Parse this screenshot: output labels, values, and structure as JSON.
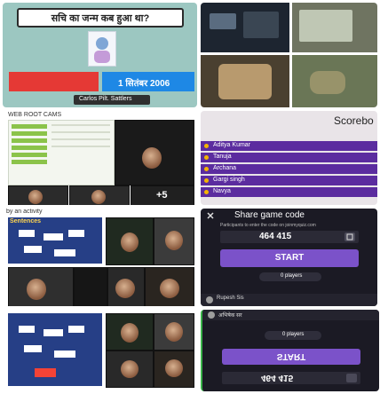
{
  "panel_a": {
    "question": "सचि का जन्म कब हुआ था?",
    "answer_option": "1 सितंबर 2006",
    "cursor_label": "Carlos Pilt. Sattlers"
  },
  "panel_c": {
    "header": "WEB ROOT CAMS",
    "tile_count_label": "+5"
  },
  "panel_d": {
    "title": "Scorebo",
    "players": [
      "Aditya Kumar",
      "Tanuja",
      "Archana",
      "Gargi singh",
      "Navya"
    ]
  },
  "panel_e": {
    "header": "by an activity",
    "tab_label": "Sentences"
  },
  "panel_f": {
    "share_label": "Share game code",
    "instructions": "Participants to enter the code on joinmyquiz.com",
    "code": "464 415",
    "start_label": "START",
    "players_label": "0 players",
    "host_label": "Rupesh Sis"
  },
  "panel_h": {
    "host_label": "अभिषेक सर",
    "players_label": "0 players",
    "start_label": "START",
    "code": "464 415"
  },
  "colors": {
    "accent_purple": "#7b52c9",
    "scoreboard_purple": "#5b2c9f",
    "answer_red": "#e53935",
    "answer_blue": "#1e88e5",
    "quiz_bg": "#1b1a24"
  }
}
